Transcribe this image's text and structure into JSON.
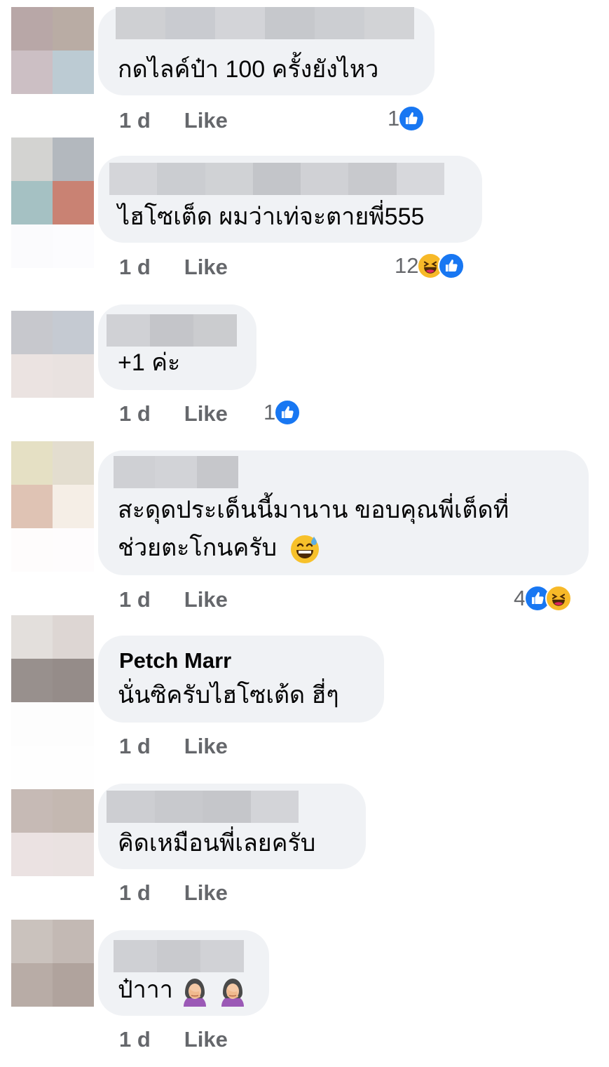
{
  "colors": {
    "bubble_bg": "#f0f2f5",
    "meta_text": "#65676b",
    "like_blue": "#1877f2",
    "haha_yellow": "#f7b928"
  },
  "comments": [
    {
      "text": "กดไลค์ป๋า 100 ครั้งยังไหว",
      "time": "1 d",
      "like_label": "Like",
      "reaction_count": "1",
      "reactions": [
        "like-icon"
      ]
    },
    {
      "text": "ไฮโซเต็ด ผมว่าเท่จะตายพี่555",
      "time": "1 d",
      "like_label": "Like",
      "reaction_count": "12",
      "reactions": [
        "haha-icon",
        "like-icon"
      ]
    },
    {
      "text": "+1 ค่ะ",
      "time": "1 d",
      "like_label": "Like",
      "reaction_count": "1",
      "reactions": [
        "like-icon"
      ]
    },
    {
      "text_line1": "สะดุดประเด็นนี้มานาน ขอบคุณพี่เต็ดที่",
      "text_line2": "ช่วยตะโกนครับ",
      "emoji": "grinning-sweat-emoji",
      "time": "1 d",
      "like_label": "Like",
      "reaction_count": "4",
      "reactions": [
        "like-icon",
        "haha-icon"
      ]
    },
    {
      "author": "Petch Marr",
      "text": "นั่นซิครับไฮโซเต้ด ฮี่ๆ",
      "time": "1 d",
      "like_label": "Like"
    },
    {
      "text": "คิดเหมือนพี่เลยครับ",
      "time": "1 d",
      "like_label": "Like"
    },
    {
      "text": "ป๋าาา",
      "emoji": "woman-facepalming-emoji",
      "time": "1 d",
      "like_label": "Like"
    }
  ]
}
